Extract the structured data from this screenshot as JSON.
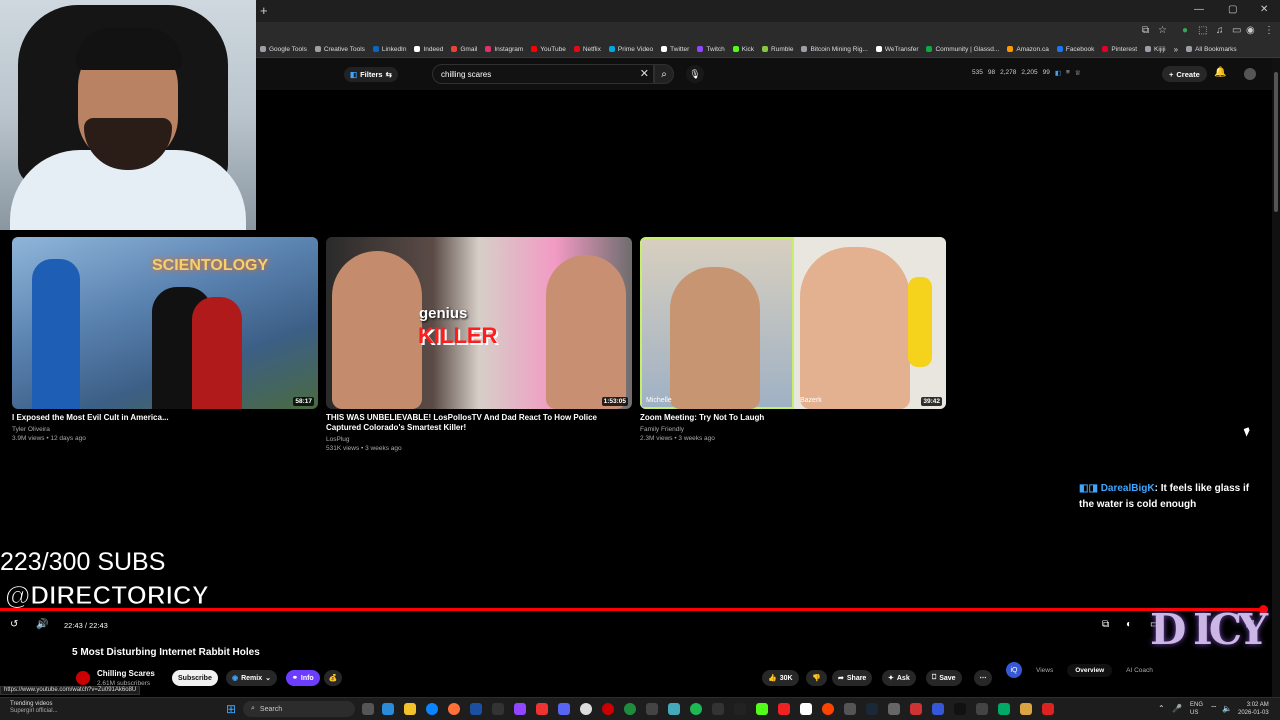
{
  "browser": {
    "new_tab": "+",
    "bookmarks": [
      {
        "label": "Google Tools",
        "color": "#9aa0a6"
      },
      {
        "label": "Creative Tools",
        "color": "#9aa0a6"
      },
      {
        "label": "LinkedIn",
        "color": "#0a66c2"
      },
      {
        "label": "Indeed",
        "color": "#ffffff"
      },
      {
        "label": "Gmail",
        "color": "#ea4335"
      },
      {
        "label": "Instagram",
        "color": "#e1306c"
      },
      {
        "label": "YouTube",
        "color": "#ff0000"
      },
      {
        "label": "Netflix",
        "color": "#e50914"
      },
      {
        "label": "Prime Video",
        "color": "#00a8e1"
      },
      {
        "label": "Twitter",
        "color": "#ffffff"
      },
      {
        "label": "Twitch",
        "color": "#9146ff"
      },
      {
        "label": "Kick",
        "color": "#53fc18"
      },
      {
        "label": "Rumble",
        "color": "#85c742"
      },
      {
        "label": "Bitcoin Mining Rig...",
        "color": "#9aa0a6"
      },
      {
        "label": "WeTransfer",
        "color": "#ffffff"
      },
      {
        "label": "Community | Glassd...",
        "color": "#0caa41"
      },
      {
        "label": "Amazon.ca",
        "color": "#ff9900"
      },
      {
        "label": "Facebook",
        "color": "#1877f2"
      },
      {
        "label": "Pinterest",
        "color": "#e60023"
      },
      {
        "label": "Kijiji",
        "color": "#9aa0a6"
      }
    ],
    "all_bookmarks": "All Bookmarks"
  },
  "masthead": {
    "filters_label": "Filters",
    "search_value": "chilling scares",
    "stats": [
      "535",
      "98",
      "2,278",
      "2,205",
      "99"
    ],
    "create_label": "Create"
  },
  "videos": [
    {
      "title": "I Exposed the Most Evil Cult in America...",
      "channel": "Tyler Oliveira",
      "meta": "3.9M views • 12 days ago",
      "duration": "58:17",
      "thumb_text": "SCIENTOLOGY"
    },
    {
      "title": "THIS WAS UNBELIEVABLE! LosPollosTV And Dad React To How Police Captured Colorado's Smartest Killer!",
      "channel": "LosPlug",
      "meta": "531K views • 3 weeks ago",
      "duration": "1:53:05",
      "thumb_text_1": "genius",
      "thumb_text_2": "KILLER"
    },
    {
      "title": "Zoom Meeting: Try Not To Laugh",
      "channel": "Family Friendly",
      "meta": "2.3M views • 3 weeks ago",
      "duration": "39:42",
      "name_left": "Michelle",
      "name_right": "Bazerk"
    }
  ],
  "overlay": {
    "chat_user": "DarealBigK",
    "chat_text": ": It feels like glass if the water is cold enough",
    "subs": "223/300 SUBS",
    "handle": "@DIRECTORICY",
    "logo_text": "D ICY"
  },
  "player": {
    "progress_fraction": 0.996,
    "timecode": "22:43 / 22:43",
    "title": "5 Most Disturbing Internet Rabbit Holes",
    "channel_name": "Chilling Scares",
    "channel_subs": "2.61M subscribers",
    "subscribe_label": "Subscribe",
    "remix_label": "Remix",
    "info_label": "Info",
    "likes": "30K",
    "share_label": "Share",
    "ask_label": "Ask",
    "save_label": "Save",
    "panel_tabs": [
      "Views",
      "Overview",
      "AI Coach"
    ]
  },
  "status_url": "https://www.youtube.com/watch?v=Zu091Ak6o8U",
  "taskbar": {
    "trend_title": "Trending videos",
    "trend_sub": "Supergirl official...",
    "search_label": "Search",
    "lang_1": "ENG",
    "lang_2": "US",
    "time": "3:02 AM",
    "date": "2026-01-03"
  }
}
